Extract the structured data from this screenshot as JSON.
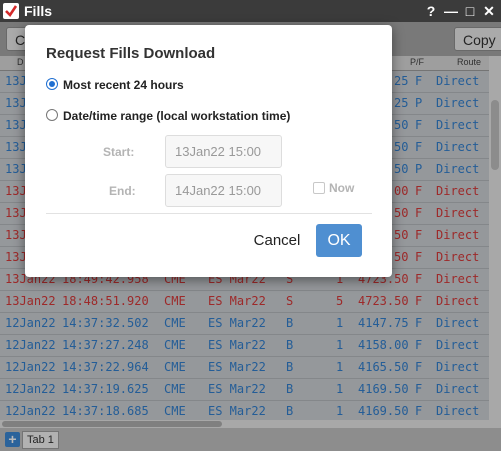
{
  "window": {
    "title": "Fills",
    "controls": [
      "?",
      "—",
      "□",
      "✕"
    ]
  },
  "toolbar": {
    "left_button_label": "Co",
    "copy_label": "Copy"
  },
  "grid": {
    "headers": {
      "first": "D",
      "pf": "P/F",
      "route": "Route"
    },
    "partial_rows": [
      {
        "date": "13J",
        "price_tail": "25",
        "pf": "F",
        "route": "Direct",
        "color": "#2277cc"
      },
      {
        "date": "13J",
        "price_tail": "25",
        "pf": "P",
        "route": "Direct",
        "color": "#2277cc"
      },
      {
        "date": "13J",
        "price_tail": "50",
        "pf": "F",
        "route": "Direct",
        "color": "#2277cc"
      },
      {
        "date": "13J",
        "price_tail": "50",
        "pf": "F",
        "route": "Direct",
        "color": "#2277cc"
      },
      {
        "date": "13J",
        "price_tail": "50",
        "pf": "P",
        "route": "Direct",
        "color": "#2277cc"
      },
      {
        "date": "13J",
        "price_tail": "00",
        "pf": "F",
        "route": "Direct",
        "color": "#d42a2a"
      },
      {
        "date": "13J",
        "price_tail": "50",
        "pf": "F",
        "route": "Direct",
        "color": "#d42a2a"
      },
      {
        "date": "13J",
        "price_tail": "50",
        "pf": "F",
        "route": "Direct",
        "color": "#d42a2a"
      },
      {
        "date": "13J",
        "price_tail": "50",
        "pf": "F",
        "route": "Direct",
        "color": "#d42a2a"
      }
    ],
    "partial_row_10": {
      "date": "13Jan22",
      "time": "18:49:42.958",
      "exch": "CME",
      "contract": "ES Mar22",
      "side": "S",
      "qty": "1",
      "price": "4723.50",
      "pf": "F",
      "route": "Direct",
      "color": "#d42a2a"
    },
    "rows": [
      {
        "date": "13Jan22",
        "time": "18:48:51.920",
        "exch": "CME",
        "contract": "ES Mar22",
        "side": "S",
        "qty": "5",
        "price": "4723.50",
        "pf": "F",
        "route": "Direct",
        "color": "#d42a2a"
      },
      {
        "date": "12Jan22",
        "time": "14:37:32.502",
        "exch": "CME",
        "contract": "ES Mar22",
        "side": "B",
        "qty": "1",
        "price": "4147.75",
        "pf": "F",
        "route": "Direct",
        "color": "#2277cc"
      },
      {
        "date": "12Jan22",
        "time": "14:37:27.248",
        "exch": "CME",
        "contract": "ES Mar22",
        "side": "B",
        "qty": "1",
        "price": "4158.00",
        "pf": "F",
        "route": "Direct",
        "color": "#2277cc"
      },
      {
        "date": "12Jan22",
        "time": "14:37:22.964",
        "exch": "CME",
        "contract": "ES Mar22",
        "side": "B",
        "qty": "1",
        "price": "4165.50",
        "pf": "F",
        "route": "Direct",
        "color": "#2277cc"
      },
      {
        "date": "12Jan22",
        "time": "14:37:19.625",
        "exch": "CME",
        "contract": "ES Mar22",
        "side": "B",
        "qty": "1",
        "price": "4169.50",
        "pf": "F",
        "route": "Direct",
        "color": "#2277cc"
      },
      {
        "date": "12Jan22",
        "time": "14:37:18.685",
        "exch": "CME",
        "contract": "ES Mar22",
        "side": "B",
        "qty": "1",
        "price": "4169.50",
        "pf": "F",
        "route": "Direct",
        "color": "#2277cc"
      }
    ]
  },
  "tabs": {
    "add_label": "+",
    "tab_label": "Tab 1"
  },
  "dialog": {
    "title": "Request Fills Download",
    "option_recent": "Most recent 24 hours",
    "option_range": "Date/time range (local workstation time)",
    "start_label": "Start:",
    "start_value": "13Jan22 15:00",
    "end_label": "End:",
    "end_value": "14Jan22 15:00",
    "now_label": "Now",
    "cancel_label": "Cancel",
    "ok_label": "OK"
  }
}
